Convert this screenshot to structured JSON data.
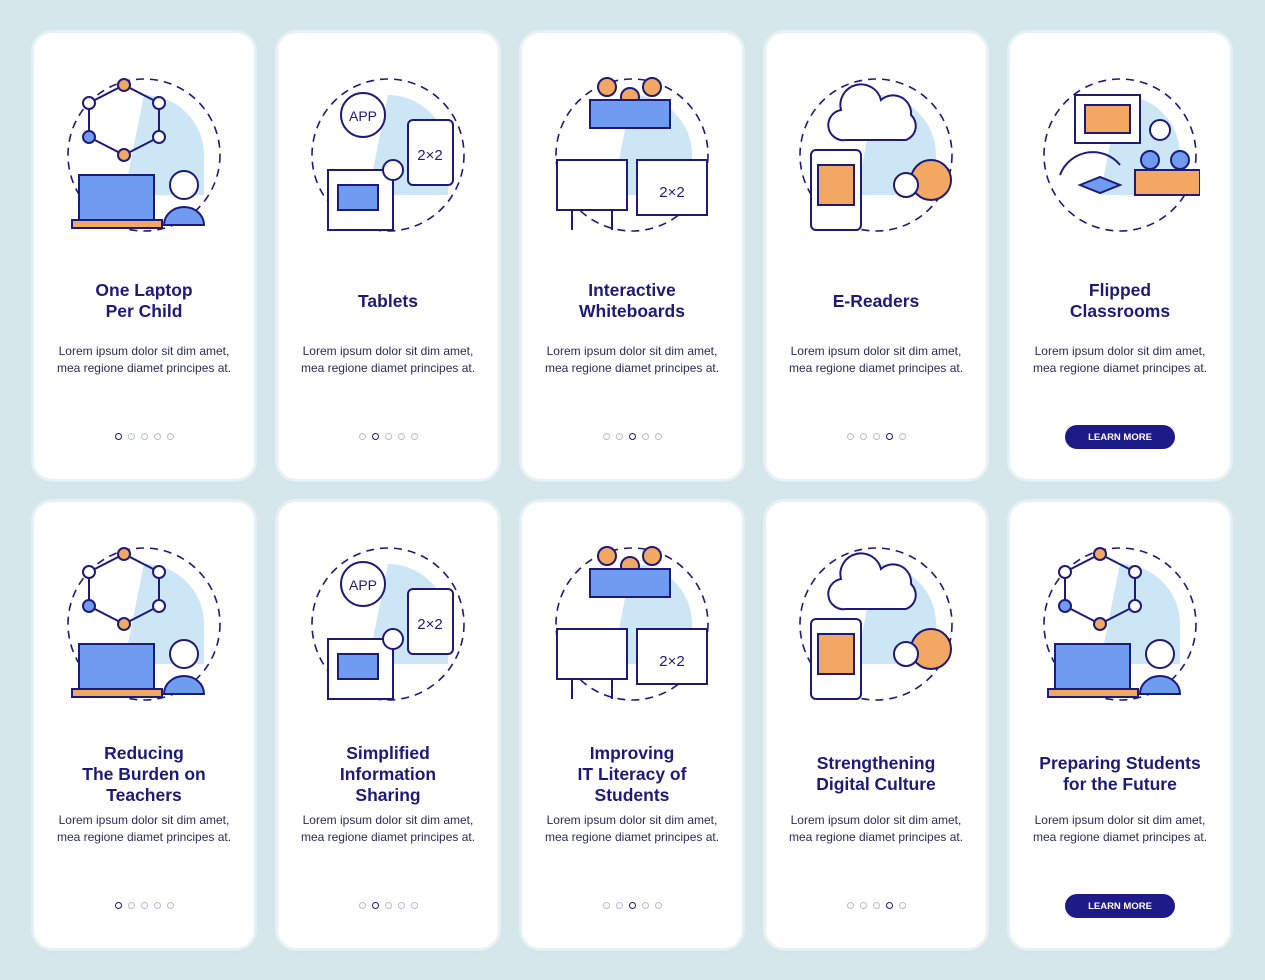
{
  "colors": {
    "title": "#1e1a78",
    "accent_orange": "#f2a862",
    "accent_blue": "#6f9cf0",
    "light_blue": "#cde6f6",
    "button": "#1e1a88",
    "background": "#d5e7eb"
  },
  "cards": [
    {
      "title": "One Laptop\nPer Child",
      "body": "Lorem ipsum dolor sit dim amet, mea regione diamet principes at.",
      "active_dot": 0,
      "icon": "laptop-child-icon"
    },
    {
      "title": "Tablets",
      "body": "Lorem ipsum dolor sit dim amet, mea regione diamet principes at.",
      "active_dot": 1,
      "icon": "tablet-app-icon"
    },
    {
      "title": "Interactive\nWhiteboards",
      "body": "Lorem ipsum dolor sit dim amet, mea regione diamet principes at.",
      "active_dot": 2,
      "icon": "whiteboard-icon"
    },
    {
      "title": "E-Readers",
      "body": "Lorem ipsum dolor sit dim amet, mea regione diamet principes at.",
      "active_dot": 3,
      "icon": "ereader-icon"
    },
    {
      "title": "Flipped\nClassrooms",
      "body": "Lorem ipsum dolor sit dim amet, mea regione diamet principes at.",
      "button": "LEARN MORE",
      "icon": "flipped-classroom-icon"
    },
    {
      "title": "Reducing\nThe Burden on\nTeachers",
      "body": "Lorem ipsum dolor sit dim amet, mea regione diamet principes at.",
      "active_dot": 0,
      "icon": "teacher-multitask-icon"
    },
    {
      "title": "Simplified\nInformation\nSharing",
      "body": "Lorem ipsum dolor sit dim amet, mea regione diamet principes at.",
      "active_dot": 1,
      "icon": "information-sharing-icon"
    },
    {
      "title": "Improving\nIT Literacy of\nStudents",
      "body": "Lorem ipsum dolor sit dim amet, mea regione diamet principes at.",
      "active_dot": 2,
      "icon": "it-literacy-icon"
    },
    {
      "title": "Strengthening\nDigital Culture",
      "body": "Lorem ipsum dolor sit dim amet, mea regione diamet principes at.",
      "active_dot": 3,
      "icon": "digital-culture-icon"
    },
    {
      "title": "Preparing Students\nfor the Future",
      "body": "Lorem ipsum dolor sit dim amet, mea regione diamet principes at.",
      "button": "LEARN MORE",
      "icon": "future-students-icon"
    }
  ],
  "illustration_labels": {
    "app": "APP",
    "math": "2×2"
  }
}
